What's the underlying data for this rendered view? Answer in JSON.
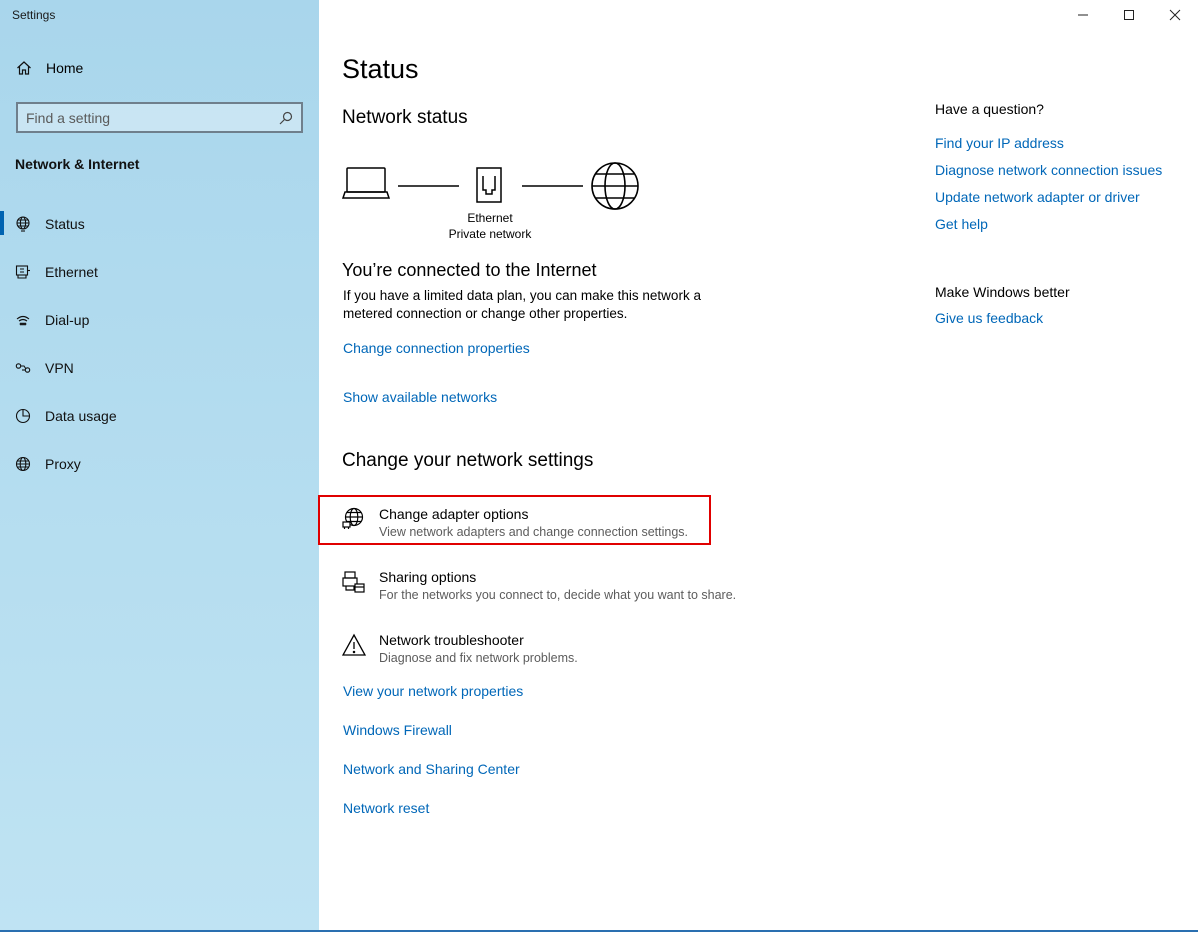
{
  "app": {
    "title": "Settings"
  },
  "window_controls": [
    "minimize-icon",
    "maximize-icon",
    "close-icon"
  ],
  "sidebar": {
    "home_label": "Home",
    "search_placeholder": "Find a setting",
    "section_title": "Network & Internet",
    "items": [
      {
        "label": "Status",
        "icon": "status-globe-icon",
        "active": true
      },
      {
        "label": "Ethernet",
        "icon": "ethernet-icon",
        "active": false
      },
      {
        "label": "Dial-up",
        "icon": "dialup-icon",
        "active": false
      },
      {
        "label": "VPN",
        "icon": "vpn-icon",
        "active": false
      },
      {
        "label": "Data usage",
        "icon": "data-usage-icon",
        "active": false
      },
      {
        "label": "Proxy",
        "icon": "proxy-globe-icon",
        "active": false
      }
    ]
  },
  "main": {
    "title": "Status",
    "network_status_heading": "Network status",
    "diagram": {
      "adapter_name": "Ethernet",
      "network_type": "Private network"
    },
    "connected_heading": "You’re connected to the Internet",
    "connected_desc_line1": "If you have a limited data plan, you can make this network a",
    "connected_desc_line2": "metered connection or change other properties.",
    "link_change_connection": "Change connection properties",
    "link_show_networks": "Show available networks",
    "change_heading": "Change your network settings",
    "options": [
      {
        "title": "Change adapter options",
        "subtitle": "View network adapters and change connection settings.",
        "icon": "adapter-globe-icon"
      },
      {
        "title": "Sharing options",
        "subtitle": "For the networks you connect to, decide what you want to share.",
        "icon": "sharing-icon"
      },
      {
        "title": "Network troubleshooter",
        "subtitle": "Diagnose and fix network problems.",
        "icon": "warning-icon"
      }
    ],
    "links": [
      "View your network properties",
      "Windows Firewall",
      "Network and Sharing Center",
      "Network reset"
    ]
  },
  "help": {
    "question_heading": "Have a question?",
    "question_links": [
      "Find your IP address",
      "Diagnose network connection issues",
      "Update network adapter or driver",
      "Get help"
    ],
    "better_heading": "Make Windows better",
    "feedback_link": "Give us feedback"
  },
  "colors": {
    "link": "#0067b8",
    "highlight": "#e00000",
    "accent": "#0063b1"
  }
}
